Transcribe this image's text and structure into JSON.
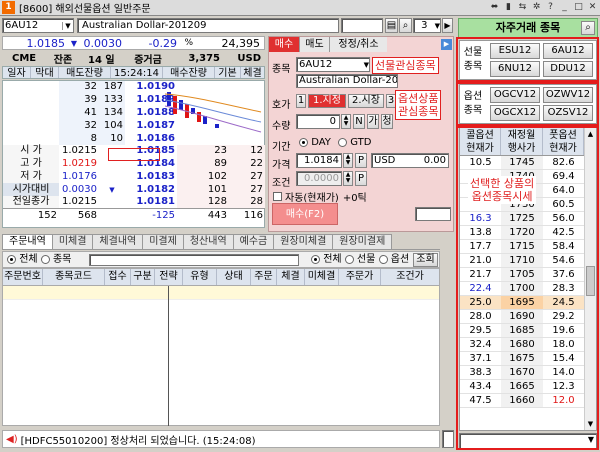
{
  "window": {
    "icon_text": "1",
    "title": "[8600] 해외선물옵션 일반주문"
  },
  "symbol": {
    "code": "6AU12",
    "name": "Australian Dollar-201209",
    "page_num": "3"
  },
  "quote": {
    "price": "1.0185",
    "change": "0.0030",
    "change_pct": "-0.29",
    "pct_sign": "%",
    "volume": "24,395",
    "exchange": "CME",
    "days_label": "잔존",
    "days": "14 일",
    "oi_label": "증거금",
    "oi": "3,375",
    "currency": "USD"
  },
  "orderbook": {
    "headers": [
      "일자",
      "막대",
      "매도잔량",
      "15:24:14",
      "매수잔량",
      "기본",
      "체결"
    ],
    "asks": [
      {
        "qty": "32",
        "cnt": "187",
        "price": "1.0190"
      },
      {
        "qty": "39",
        "cnt": "133",
        "price": "1.0189"
      },
      {
        "qty": "41",
        "cnt": "134",
        "price": "1.0188"
      },
      {
        "qty": "32",
        "cnt": "104",
        "price": "1.0187"
      },
      {
        "qty": "8",
        "cnt": "10",
        "price": "1.0186"
      }
    ],
    "bids": [
      {
        "label": "시 가",
        "lv": "1.0215",
        "price": "1.0185",
        "cnt": "23",
        "qty": "12"
      },
      {
        "label": "고 가",
        "lv": "1.0219",
        "price": "1.0184",
        "cnt": "89",
        "qty": "22"
      },
      {
        "label": "저 가",
        "lv": "1.0176",
        "price": "1.0183",
        "cnt": "102",
        "qty": "27"
      },
      {
        "label": "시가대비",
        "lv": "0.0030",
        "price": "1.0182",
        "cnt": "101",
        "qty": "27"
      },
      {
        "label": "전일종가",
        "lv": "1.0215",
        "price": "1.0181",
        "cnt": "128",
        "qty": "28"
      }
    ],
    "totals": {
      "ask_qty": "152",
      "ask_cnt": "568",
      "diff": "-125",
      "bid_cnt": "443",
      "bid_qty": "116"
    }
  },
  "order": {
    "tabs": [
      "매수",
      "매도",
      "정정/취소"
    ],
    "symbol_label": "종목",
    "symbol_code": "6AU12",
    "symbol_name": "Australian Dollar-201209",
    "type_label": "호가",
    "type_opts": [
      "1",
      "1.지정",
      "2.시장",
      "3"
    ],
    "qty_label": "수량",
    "qty": "0",
    "qty_btns": [
      "N",
      "가",
      "청"
    ],
    "period_label": "기간",
    "period_opts": [
      "DAY",
      "GTD"
    ],
    "price_label": "가격",
    "price": "1.0184",
    "p_btn": "P",
    "currency": "USD",
    "amount": "0.00",
    "cond_label": "조건",
    "cond": "0.0000",
    "auto_label": "자동(현재가)",
    "auto_tick": "+0틱",
    "submit": "매수(F2)"
  },
  "bottom": {
    "tabs": [
      "주문내역",
      "미체결",
      "체결내역",
      "미결제",
      "청산내역",
      "예수금",
      "원장미체결",
      "원장미결제"
    ],
    "filter_left": [
      "전체",
      "종목"
    ],
    "filter_right": [
      "전체",
      "선물",
      "옵션"
    ],
    "query": "조회",
    "columns": [
      "주문번호",
      "종목코드",
      "접수",
      "구분",
      "전략",
      "유형",
      "상태",
      "주문",
      "체결",
      "미체결",
      "주문가",
      "조건가"
    ]
  },
  "status_bar": {
    "message": "[HDFC55010200] 정상처리 되었습니다. (15:24:08)"
  },
  "right": {
    "title": "자주거래 종목",
    "futures_label": [
      "선물",
      "종목"
    ],
    "futures": [
      "ESU12",
      "6AU12",
      "6NU12",
      "DDU12"
    ],
    "options_label": [
      "옵션",
      "종목"
    ],
    "options": [
      "OGCV12",
      "OZWV12",
      "OGCX12",
      "OZSV12"
    ],
    "opt_headers": [
      [
        "콜옵션",
        "현재가"
      ],
      [
        "재정월",
        "행사가"
      ],
      [
        "풋옵션",
        "현재가"
      ]
    ],
    "opt_rows": [
      [
        "10.5",
        "1745",
        "82.6"
      ],
      [
        "",
        "1740",
        "69.4"
      ],
      [
        "",
        "1735",
        "64.0"
      ],
      [
        "",
        "1730",
        "60.5"
      ],
      [
        "16.3",
        "1725",
        "56.0"
      ],
      [
        "13.8",
        "1720",
        "42.5"
      ],
      [
        "17.7",
        "1715",
        "58.4"
      ],
      [
        "21.0",
        "1710",
        "54.6"
      ],
      [
        "21.7",
        "1705",
        "37.6"
      ],
      [
        "22.4",
        "1700",
        "28.3"
      ],
      [
        "25.0",
        "1695",
        "24.5"
      ],
      [
        "28.0",
        "1690",
        "29.2"
      ],
      [
        "29.5",
        "1685",
        "19.6"
      ],
      [
        "32.4",
        "1680",
        "18.0"
      ],
      [
        "37.1",
        "1675",
        "15.4"
      ],
      [
        "38.3",
        "1670",
        "14.0"
      ],
      [
        "43.4",
        "1665",
        "12.3"
      ],
      [
        "47.5",
        "1660",
        "12.0"
      ]
    ]
  },
  "annotations": {
    "fut_interest": "선물관심종목",
    "opt_interest": [
      "옵션상품",
      "관심종목"
    ],
    "opt_quote": [
      "선택한 상품의",
      "옵션종목시세"
    ]
  }
}
